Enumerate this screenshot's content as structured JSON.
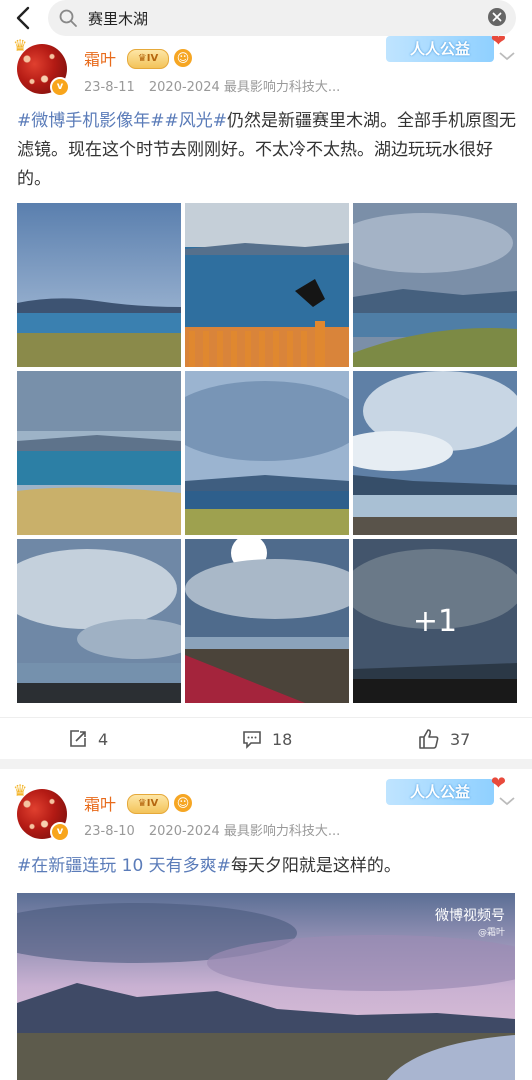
{
  "search": {
    "query": "赛里木湖"
  },
  "posts": [
    {
      "username": "霜叶",
      "level": "IV",
      "date": "23-8-11",
      "source": "2020-2024 最具影响力科技大...",
      "charity": "人人公益",
      "text_parts": [
        {
          "text": "#微博手机影像年#",
          "tag": true
        },
        {
          "text": "#风光#",
          "tag": true
        },
        {
          "text": "仍然是新疆赛里木湖。全部手机原图无滤镜。现在这个时节去刚刚好。不太冷不太热。湖边玩玩水很好的。",
          "tag": false
        }
      ],
      "extra_photos": "+1",
      "reposts": "4",
      "comments": "18",
      "likes": "37"
    },
    {
      "username": "霜叶",
      "level": "IV",
      "date": "23-8-10",
      "source": "2020-2024 最具影响力科技大...",
      "charity": "人人公益",
      "text_parts": [
        {
          "text": "#在新疆连玩 10 天有多爽#",
          "tag": true
        },
        {
          "text": "每天夕阳就是这样的。",
          "tag": false
        }
      ],
      "video_watermark": "微博视频号",
      "video_watermark_sub": "@霜叶"
    }
  ],
  "colors": {
    "tag": "#5b7cb9",
    "username": "#e86b1c",
    "meta": "#999999"
  }
}
